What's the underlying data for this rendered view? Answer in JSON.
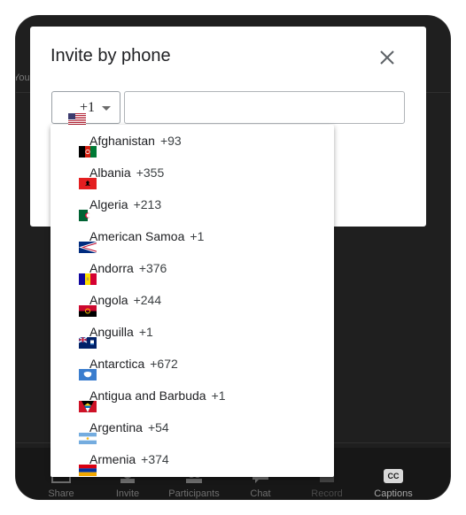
{
  "background": {
    "partial_label": "You",
    "toolbar": [
      {
        "label": "Share",
        "icon": "share-icon"
      },
      {
        "label": "Invite",
        "icon": "invite-icon"
      },
      {
        "label": "Participants",
        "icon": "participants-icon"
      },
      {
        "label": "Chat",
        "icon": "chat-icon"
      },
      {
        "label": "Record",
        "icon": "record-icon"
      },
      {
        "label": "Captions",
        "icon": "cc-icon",
        "icon_text": "CC"
      }
    ]
  },
  "dialog": {
    "title": "Invite by phone",
    "close_icon": "close-icon",
    "country_select": {
      "flag": "us-flag-icon",
      "code": "+1"
    },
    "phone_input": {
      "value": "",
      "placeholder": ""
    }
  },
  "dropdown": {
    "options": [
      {
        "name": "Afghanistan",
        "code": "+93",
        "flag": "af"
      },
      {
        "name": "Albania",
        "code": "+355",
        "flag": "al"
      },
      {
        "name": "Algeria",
        "code": "+213",
        "flag": "dz"
      },
      {
        "name": "American Samoa",
        "code": "+1",
        "flag": "as"
      },
      {
        "name": "Andorra",
        "code": "+376",
        "flag": "ad"
      },
      {
        "name": "Angola",
        "code": "+244",
        "flag": "ao"
      },
      {
        "name": "Anguilla",
        "code": "+1",
        "flag": "ai"
      },
      {
        "name": "Antarctica",
        "code": "+672",
        "flag": "aq"
      },
      {
        "name": "Antigua and Barbuda",
        "code": "+1",
        "flag": "ag"
      },
      {
        "name": "Argentina",
        "code": "+54",
        "flag": "ar"
      },
      {
        "name": "Armenia",
        "code": "+374",
        "flag": "am"
      }
    ]
  },
  "colors": {
    "device_bg": "#1f1f1f",
    "dialog_bg": "#ffffff",
    "text": "#202124"
  }
}
